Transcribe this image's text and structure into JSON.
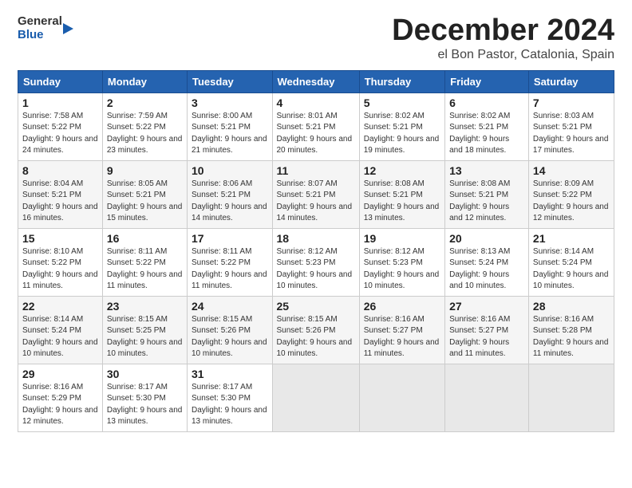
{
  "header": {
    "logo_general": "General",
    "logo_blue": "Blue",
    "title": "December 2024",
    "location": "el Bon Pastor, Catalonia, Spain"
  },
  "days_of_week": [
    "Sunday",
    "Monday",
    "Tuesday",
    "Wednesday",
    "Thursday",
    "Friday",
    "Saturday"
  ],
  "weeks": [
    [
      {
        "day": "1",
        "sunrise": "Sunrise: 7:58 AM",
        "sunset": "Sunset: 5:22 PM",
        "daylight": "Daylight: 9 hours and 24 minutes."
      },
      {
        "day": "2",
        "sunrise": "Sunrise: 7:59 AM",
        "sunset": "Sunset: 5:22 PM",
        "daylight": "Daylight: 9 hours and 23 minutes."
      },
      {
        "day": "3",
        "sunrise": "Sunrise: 8:00 AM",
        "sunset": "Sunset: 5:21 PM",
        "daylight": "Daylight: 9 hours and 21 minutes."
      },
      {
        "day": "4",
        "sunrise": "Sunrise: 8:01 AM",
        "sunset": "Sunset: 5:21 PM",
        "daylight": "Daylight: 9 hours and 20 minutes."
      },
      {
        "day": "5",
        "sunrise": "Sunrise: 8:02 AM",
        "sunset": "Sunset: 5:21 PM",
        "daylight": "Daylight: 9 hours and 19 minutes."
      },
      {
        "day": "6",
        "sunrise": "Sunrise: 8:02 AM",
        "sunset": "Sunset: 5:21 PM",
        "daylight": "Daylight: 9 hours and 18 minutes."
      },
      {
        "day": "7",
        "sunrise": "Sunrise: 8:03 AM",
        "sunset": "Sunset: 5:21 PM",
        "daylight": "Daylight: 9 hours and 17 minutes."
      }
    ],
    [
      {
        "day": "8",
        "sunrise": "Sunrise: 8:04 AM",
        "sunset": "Sunset: 5:21 PM",
        "daylight": "Daylight: 9 hours and 16 minutes."
      },
      {
        "day": "9",
        "sunrise": "Sunrise: 8:05 AM",
        "sunset": "Sunset: 5:21 PM",
        "daylight": "Daylight: 9 hours and 15 minutes."
      },
      {
        "day": "10",
        "sunrise": "Sunrise: 8:06 AM",
        "sunset": "Sunset: 5:21 PM",
        "daylight": "Daylight: 9 hours and 14 minutes."
      },
      {
        "day": "11",
        "sunrise": "Sunrise: 8:07 AM",
        "sunset": "Sunset: 5:21 PM",
        "daylight": "Daylight: 9 hours and 14 minutes."
      },
      {
        "day": "12",
        "sunrise": "Sunrise: 8:08 AM",
        "sunset": "Sunset: 5:21 PM",
        "daylight": "Daylight: 9 hours and 13 minutes."
      },
      {
        "day": "13",
        "sunrise": "Sunrise: 8:08 AM",
        "sunset": "Sunset: 5:21 PM",
        "daylight": "Daylight: 9 hours and 12 minutes."
      },
      {
        "day": "14",
        "sunrise": "Sunrise: 8:09 AM",
        "sunset": "Sunset: 5:22 PM",
        "daylight": "Daylight: 9 hours and 12 minutes."
      }
    ],
    [
      {
        "day": "15",
        "sunrise": "Sunrise: 8:10 AM",
        "sunset": "Sunset: 5:22 PM",
        "daylight": "Daylight: 9 hours and 11 minutes."
      },
      {
        "day": "16",
        "sunrise": "Sunrise: 8:11 AM",
        "sunset": "Sunset: 5:22 PM",
        "daylight": "Daylight: 9 hours and 11 minutes."
      },
      {
        "day": "17",
        "sunrise": "Sunrise: 8:11 AM",
        "sunset": "Sunset: 5:22 PM",
        "daylight": "Daylight: 9 hours and 11 minutes."
      },
      {
        "day": "18",
        "sunrise": "Sunrise: 8:12 AM",
        "sunset": "Sunset: 5:23 PM",
        "daylight": "Daylight: 9 hours and 10 minutes."
      },
      {
        "day": "19",
        "sunrise": "Sunrise: 8:12 AM",
        "sunset": "Sunset: 5:23 PM",
        "daylight": "Daylight: 9 hours and 10 minutes."
      },
      {
        "day": "20",
        "sunrise": "Sunrise: 8:13 AM",
        "sunset": "Sunset: 5:24 PM",
        "daylight": "Daylight: 9 hours and 10 minutes."
      },
      {
        "day": "21",
        "sunrise": "Sunrise: 8:14 AM",
        "sunset": "Sunset: 5:24 PM",
        "daylight": "Daylight: 9 hours and 10 minutes."
      }
    ],
    [
      {
        "day": "22",
        "sunrise": "Sunrise: 8:14 AM",
        "sunset": "Sunset: 5:24 PM",
        "daylight": "Daylight: 9 hours and 10 minutes."
      },
      {
        "day": "23",
        "sunrise": "Sunrise: 8:15 AM",
        "sunset": "Sunset: 5:25 PM",
        "daylight": "Daylight: 9 hours and 10 minutes."
      },
      {
        "day": "24",
        "sunrise": "Sunrise: 8:15 AM",
        "sunset": "Sunset: 5:26 PM",
        "daylight": "Daylight: 9 hours and 10 minutes."
      },
      {
        "day": "25",
        "sunrise": "Sunrise: 8:15 AM",
        "sunset": "Sunset: 5:26 PM",
        "daylight": "Daylight: 9 hours and 10 minutes."
      },
      {
        "day": "26",
        "sunrise": "Sunrise: 8:16 AM",
        "sunset": "Sunset: 5:27 PM",
        "daylight": "Daylight: 9 hours and 11 minutes."
      },
      {
        "day": "27",
        "sunrise": "Sunrise: 8:16 AM",
        "sunset": "Sunset: 5:27 PM",
        "daylight": "Daylight: 9 hours and 11 minutes."
      },
      {
        "day": "28",
        "sunrise": "Sunrise: 8:16 AM",
        "sunset": "Sunset: 5:28 PM",
        "daylight": "Daylight: 9 hours and 11 minutes."
      }
    ],
    [
      {
        "day": "29",
        "sunrise": "Sunrise: 8:16 AM",
        "sunset": "Sunset: 5:29 PM",
        "daylight": "Daylight: 9 hours and 12 minutes."
      },
      {
        "day": "30",
        "sunrise": "Sunrise: 8:17 AM",
        "sunset": "Sunset: 5:30 PM",
        "daylight": "Daylight: 9 hours and 13 minutes."
      },
      {
        "day": "31",
        "sunrise": "Sunrise: 8:17 AM",
        "sunset": "Sunset: 5:30 PM",
        "daylight": "Daylight: 9 hours and 13 minutes."
      },
      null,
      null,
      null,
      null
    ]
  ]
}
